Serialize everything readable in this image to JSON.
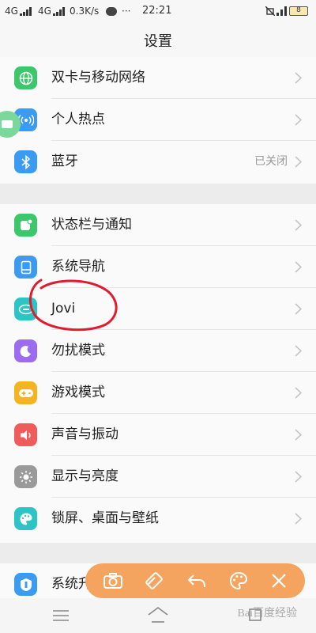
{
  "status_bar": {
    "net1": "4G",
    "net2": "4G",
    "speed": "0.3K/s",
    "dots": "···",
    "time": "22:21",
    "battery": "8"
  },
  "header": {
    "title": "设置"
  },
  "settings": {
    "dual_sim": {
      "label": "双卡与移动网络",
      "icon": "globe-icon",
      "color": "#3cc86a"
    },
    "hotspot": {
      "label": "个人热点",
      "icon": "hotspot-icon",
      "color": "#3b9bf0"
    },
    "bluetooth": {
      "label": "蓝牙",
      "value": "已关闭",
      "icon": "bluetooth-icon",
      "color": "#3b9bf0"
    },
    "status_bar": {
      "label": "状态栏与通知",
      "icon": "notification-icon",
      "color": "#3cc86a"
    },
    "navigation": {
      "label": "系统导航",
      "icon": "navigation-icon",
      "color": "#3b9bf0"
    },
    "jovi": {
      "label": "Jovi",
      "icon": "jovi-icon",
      "color": "#2cc4c4"
    },
    "dnd": {
      "label": "勿扰模式",
      "icon": "moon-icon",
      "color": "#9b6cf0"
    },
    "game": {
      "label": "游戏模式",
      "icon": "gamepad-icon",
      "color": "#f5b323"
    },
    "sound": {
      "label": "声音与振动",
      "icon": "speaker-icon",
      "color": "#f05c5c"
    },
    "display": {
      "label": "显示与亮度",
      "icon": "sun-icon",
      "color": "#9a9a9a"
    },
    "lockscreen": {
      "label": "锁屏、桌面与壁纸",
      "icon": "palette-icon",
      "color": "#2cc4c4"
    },
    "update": {
      "label": "系统升级",
      "icon": "update-icon",
      "color": "#3b9bf0"
    }
  },
  "toolbar": {
    "tools": [
      "camera-icon",
      "eraser-icon",
      "undo-icon",
      "palette-icon",
      "close-icon"
    ],
    "color": "#f5a460"
  },
  "watermark": "Bai百度经验"
}
